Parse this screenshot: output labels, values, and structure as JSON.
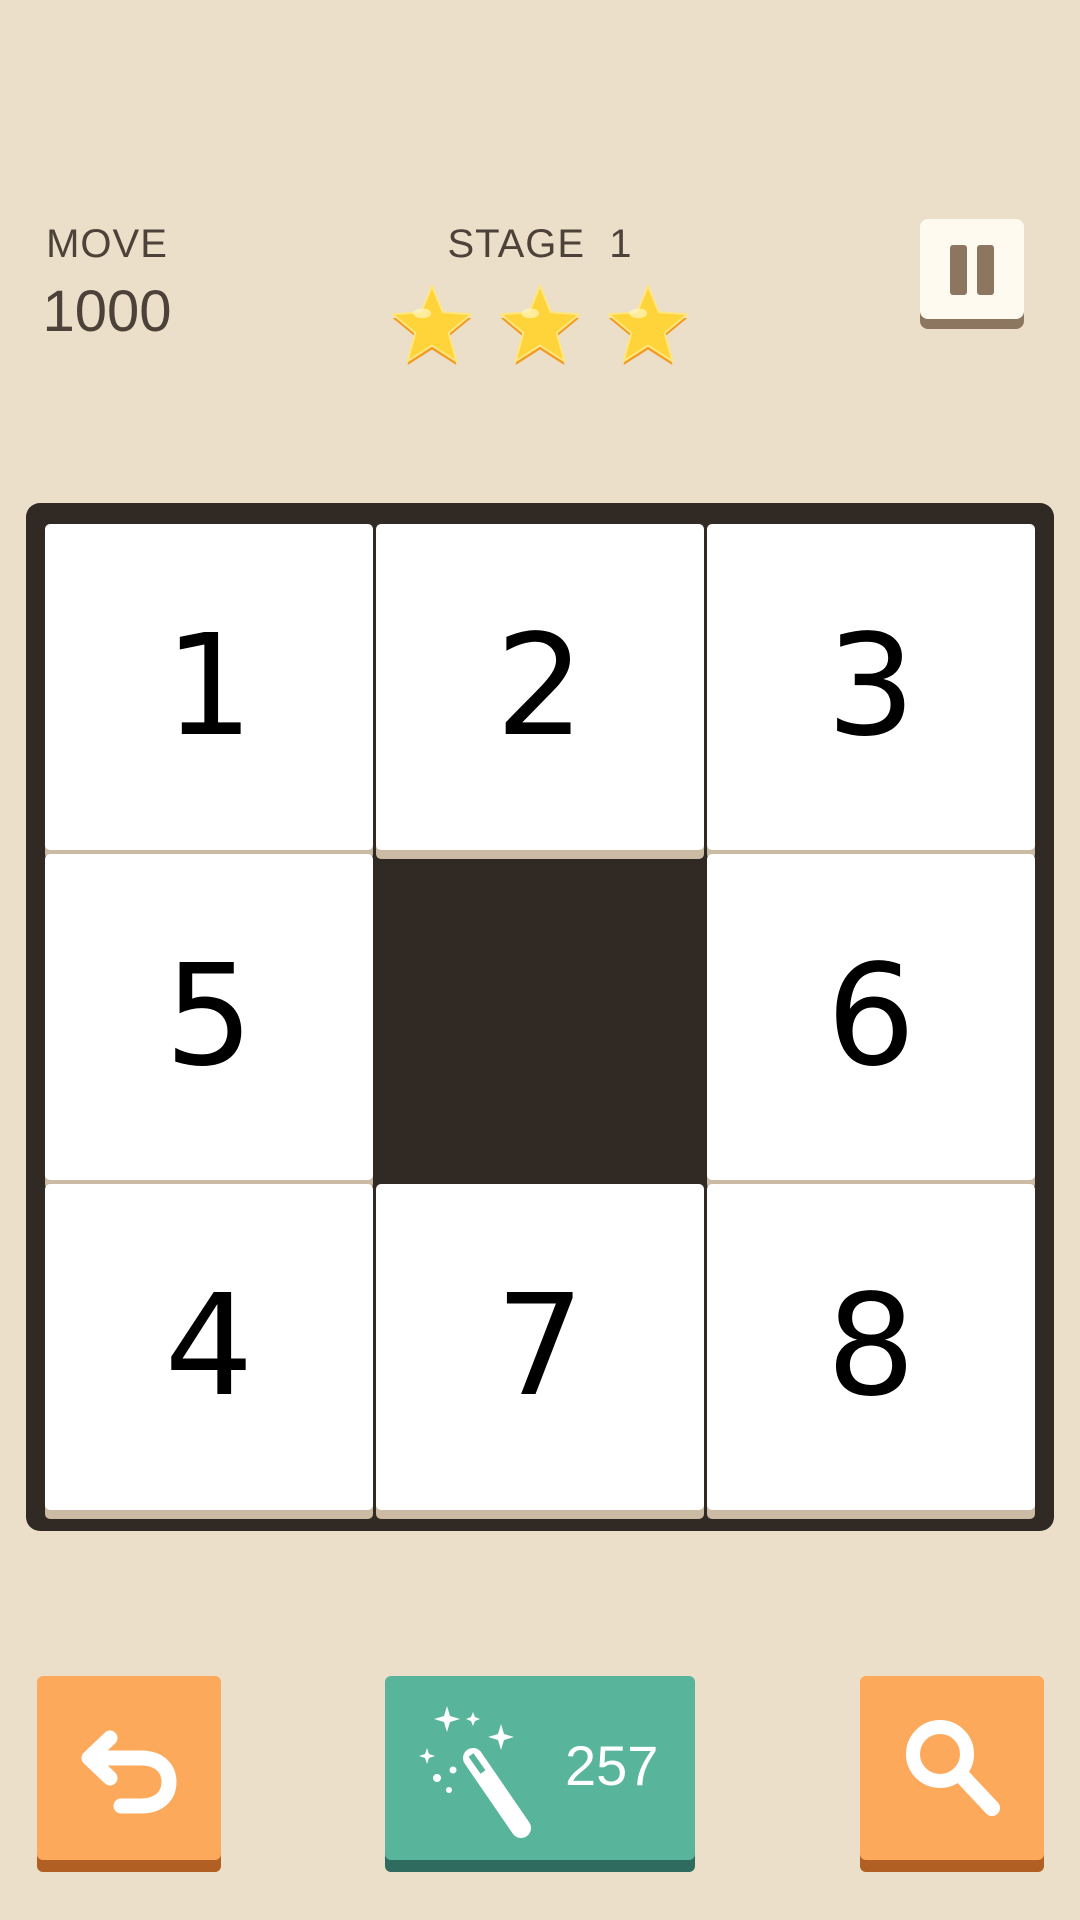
{
  "header": {
    "move_label": "MOVE",
    "move_value": "1000",
    "stage_label": "STAGE  1",
    "stars_earned": 3,
    "stars_total": 3
  },
  "board": {
    "size": 3,
    "tiles": [
      "1",
      "2",
      "3",
      "5",
      "",
      "6",
      "4",
      "7",
      "8"
    ]
  },
  "toolbar": {
    "magic_count": "257"
  },
  "colors": {
    "background": "#ecdfc9",
    "board": "#302924",
    "tile": "#ffffff",
    "orange_button": "#fda95c",
    "teal_button": "#58b59b",
    "star": "#ffd43b"
  },
  "icons": {
    "pause": "pause-icon",
    "undo": "undo-icon",
    "magic": "magic-wand-icon",
    "hint": "search-icon",
    "star": "star-icon"
  }
}
